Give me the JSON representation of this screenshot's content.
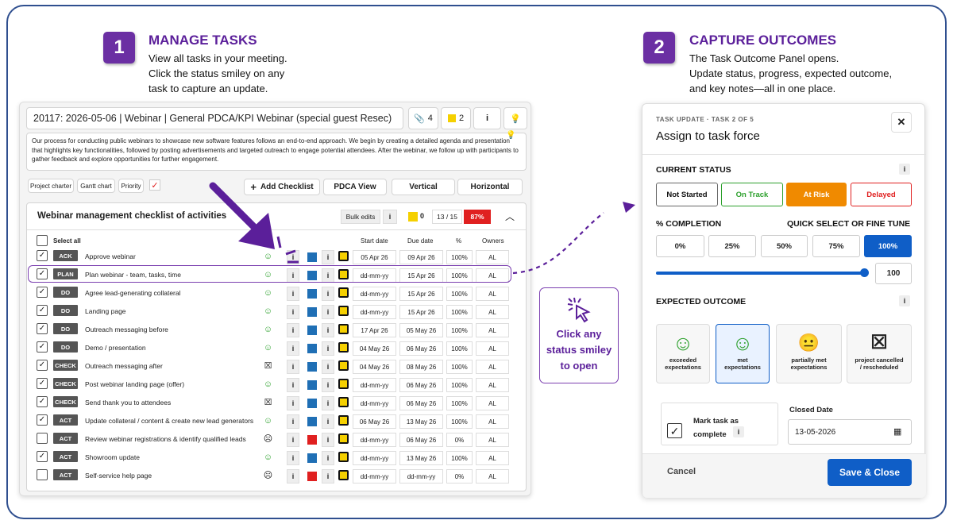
{
  "step1": {
    "number": "1",
    "title": "MANAGE TASKS",
    "lines": [
      "View all tasks in your meeting.",
      "Click the status smiley on any",
      "task to capture an update."
    ]
  },
  "step2": {
    "number": "2",
    "title": "CAPTURE OUTCOMES",
    "lines": [
      "The Task Outcome Panel opens.",
      "Update status, progress, expected outcome,",
      "and key notes—all in one place."
    ]
  },
  "meeting": {
    "title": "20117: 2026-05-06 | Webinar | General PDCA/KPI Webinar (special guest Resec)",
    "attachments": "4",
    "notes": "2",
    "description": "Our process for conducting public webinars to showcase new software features follows an end-to-end approach. We begin by creating a detailed agenda and presentation that highlights key functionalities, followed by posting advertisements and targeted outreach to engage potential attendees. After the webinar, we follow up with participants to gather feedback and explore opportunities for further engagement."
  },
  "toolbar": {
    "charter": "Project charter",
    "gantt": "Gantt chart",
    "priority": "Priority",
    "add_checklist": "Add Checklist",
    "pdca_view": "PDCA View",
    "vertical": "Vertical",
    "horizontal": "Horizontal"
  },
  "checklist": {
    "title": "Webinar management checklist of activities",
    "bulk_edits": "Bulk edits",
    "open_notes": "0",
    "progress": "13 / 15",
    "percent": "87%",
    "select_all": "Select all",
    "columns": {
      "start": "Start date",
      "due": "Due date",
      "pct": "%",
      "owners": "Owners"
    }
  },
  "tasks": [
    {
      "checked": true,
      "phase": "ACK",
      "name": "Approve webinar",
      "face": "☺",
      "status": "green",
      "flag": "blue",
      "start": "05 Apr 26",
      "due": "09 Apr 26",
      "pct": "100%",
      "owner": "AL"
    },
    {
      "checked": true,
      "phase": "PLAN",
      "name": "Plan webinar - team, tasks, time",
      "face": "☺",
      "status": "green",
      "flag": "blue",
      "start": "dd-mm-yy",
      "due": "15 Apr 26",
      "pct": "100%",
      "owner": "AL"
    },
    {
      "checked": true,
      "phase": "DO",
      "name": "Agree lead-generating collateral",
      "face": "☺",
      "status": "green",
      "flag": "blue",
      "start": "dd-mm-yy",
      "due": "15 Apr 26",
      "pct": "100%",
      "owner": "AL"
    },
    {
      "checked": true,
      "phase": "DO",
      "name": "Landing page",
      "face": "☺",
      "status": "green",
      "flag": "blue",
      "start": "dd-mm-yy",
      "due": "15 Apr 26",
      "pct": "100%",
      "owner": "AL"
    },
    {
      "checked": true,
      "phase": "DO",
      "name": "Outreach messaging before",
      "face": "☺",
      "status": "green",
      "flag": "blue",
      "start": "17 Apr 26",
      "due": "05 May 26",
      "pct": "100%",
      "owner": "AL"
    },
    {
      "checked": true,
      "phase": "DO",
      "name": "Demo / presentation",
      "face": "☺",
      "status": "green",
      "flag": "blue",
      "start": "04 May 26",
      "due": "06 May 26",
      "pct": "100%",
      "owner": "AL"
    },
    {
      "checked": true,
      "phase": "CHECK",
      "name": "Outreach messaging after",
      "face": "☒",
      "status": "cancel",
      "flag": "blue",
      "start": "04 May 26",
      "due": "08 May 26",
      "pct": "100%",
      "owner": "AL"
    },
    {
      "checked": true,
      "phase": "CHECK",
      "name": "Post webinar landing page (offer)",
      "face": "☺",
      "status": "green",
      "flag": "blue",
      "start": "dd-mm-yy",
      "due": "06 May 26",
      "pct": "100%",
      "owner": "AL"
    },
    {
      "checked": true,
      "phase": "CHECK",
      "name": "Send thank you to attendees",
      "face": "☒",
      "status": "cancel",
      "flag": "blue",
      "start": "dd-mm-yy",
      "due": "06 May 26",
      "pct": "100%",
      "owner": "AL"
    },
    {
      "checked": true,
      "phase": "ACT",
      "name": "Update collateral / content & create new lead generators",
      "face": "☺",
      "status": "green",
      "flag": "blue",
      "start": "06 May 26",
      "due": "13 May 26",
      "pct": "100%",
      "owner": "AL"
    },
    {
      "checked": false,
      "phase": "ACT",
      "name": "Review webinar registrations & identify qualified leads",
      "face": "☹",
      "status": "black",
      "flag": "red",
      "start": "dd-mm-yy",
      "due": "06 May 26",
      "pct": "0%",
      "owner": "AL"
    },
    {
      "checked": true,
      "phase": "ACT",
      "name": "Showroom update",
      "face": "☺",
      "status": "green",
      "flag": "blue",
      "start": "dd-mm-yy",
      "due": "13 May 26",
      "pct": "100%",
      "owner": "AL"
    },
    {
      "checked": false,
      "phase": "ACT",
      "name": "Self-service help page",
      "face": "☹",
      "status": "black",
      "flag": "red",
      "start": "dd-mm-yy",
      "due": "dd-mm-yy",
      "pct": "0%",
      "owner": "AL"
    }
  ],
  "callout": {
    "line1": "Click any",
    "line2": "status smiley",
    "line3": "to open"
  },
  "panel": {
    "kicker": "TASK UPDATE · TASK 2 OF 5",
    "title": "Assign to task force",
    "current_status_label": "CURRENT STATUS",
    "statuses": [
      "Not Started",
      "On Track",
      "At Risk",
      "Delayed"
    ],
    "completion_label": "% COMPLETION",
    "quick_select_label": "QUICK SELECT OR FINE TUNE",
    "percents": [
      "0%",
      "25%",
      "50%",
      "75%",
      "100%"
    ],
    "completion_value": "100",
    "expected_label": "EXPECTED OUTCOME",
    "outcomes": [
      {
        "face": "☺",
        "label": "exceeded expectations"
      },
      {
        "face": "☺",
        "label": "met expectations"
      },
      {
        "face": "😐",
        "label": "partially met expectations"
      },
      {
        "face": "☒",
        "label": "project cancelled / rescheduled"
      }
    ],
    "mark_complete": "Mark task as complete",
    "closed_date_label": "Closed Date",
    "closed_date": "13-05-2026",
    "cancel": "Cancel",
    "save": "Save & Close"
  },
  "colors": {
    "purple": "#5b1f9a",
    "blue": "#0f5ec7",
    "green": "#2ca02c",
    "orange": "#f08a00",
    "red": "#e02020"
  }
}
